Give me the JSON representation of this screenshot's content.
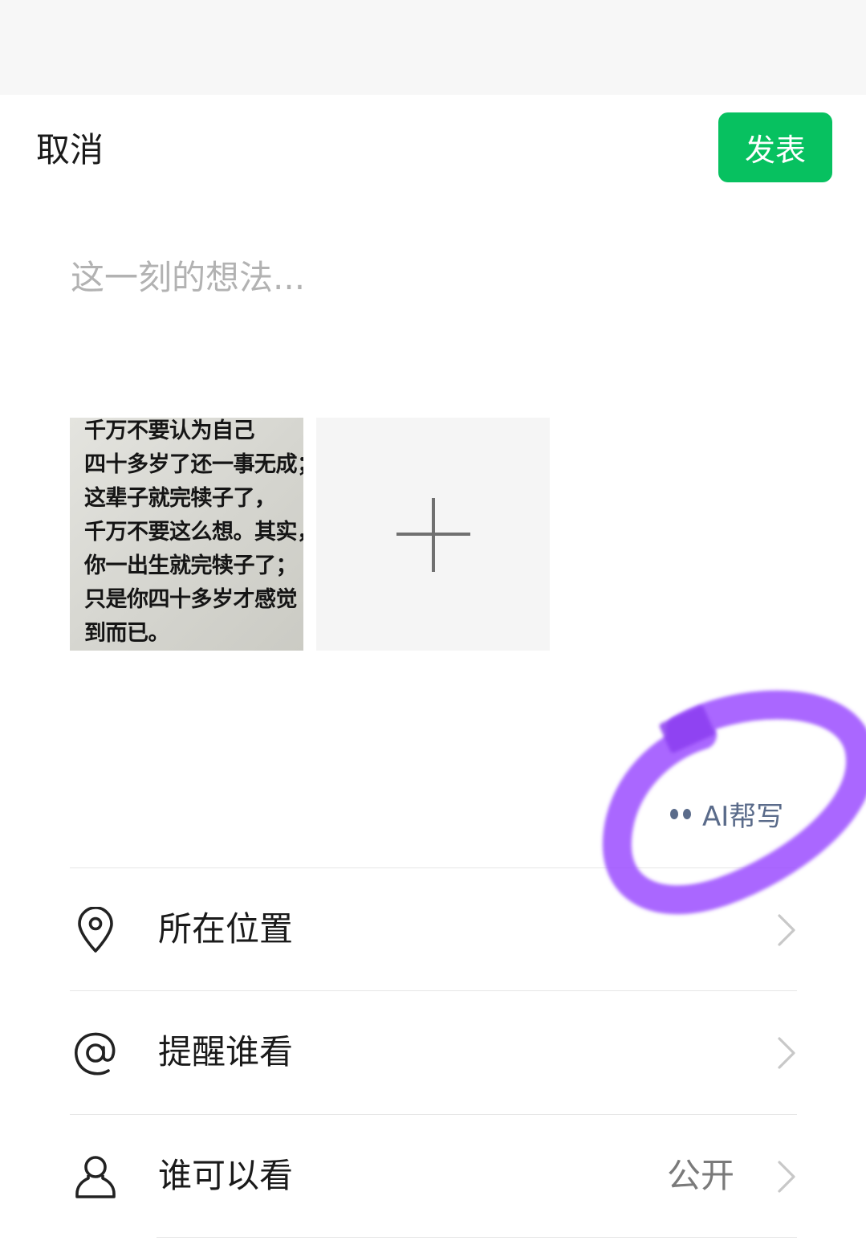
{
  "header": {
    "cancel_label": "取消",
    "publish_label": "发表"
  },
  "composer": {
    "placeholder": "这一刻的想法..."
  },
  "photo": {
    "lines": [
      "千万不要认为自己",
      "四十多岁了还一事无成；",
      "这辈子就完犊子了，",
      "千万不要这么想。其实，",
      "你一出生就完犊子了；",
      "只是你四十多岁才感觉",
      "到而已。"
    ]
  },
  "ai_write": {
    "label": "AI帮写"
  },
  "menu": {
    "location_label": "所在位置",
    "mention_label": "提醒谁看",
    "visibility_label": "谁可以看",
    "visibility_value": "公开"
  },
  "colors": {
    "accent_green": "#07c160",
    "ai_text": "#5a6b8a",
    "highlight_ring": "#9b4dff"
  },
  "icons": [
    "location-pin-icon",
    "at-sign-icon",
    "person-icon",
    "chevron-right-icon",
    "plus-icon"
  ]
}
